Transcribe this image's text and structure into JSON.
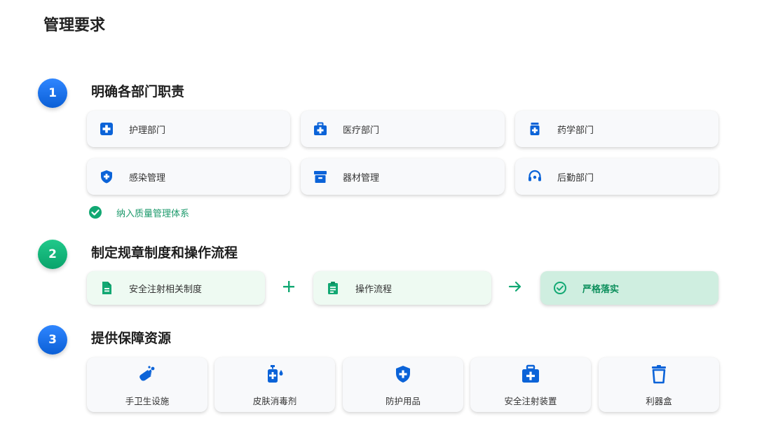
{
  "page_title": "管理要求",
  "colors": {
    "blue": "#0b63d8",
    "green": "#12a873",
    "card_bg": "#f8f9fb"
  },
  "sections": [
    {
      "number": "1",
      "title": "明确各部门职责",
      "cards": [
        {
          "label": "护理部门",
          "icon": "medical-plus-icon"
        },
        {
          "label": "医疗部门",
          "icon": "medical-kit-icon"
        },
        {
          "label": "药学部门",
          "icon": "medicine-bottle-icon"
        },
        {
          "label": "感染管理",
          "icon": "shield-plus-icon"
        },
        {
          "label": "器材管理",
          "icon": "equipment-box-icon"
        },
        {
          "label": "后勤部门",
          "icon": "support-headset-icon"
        }
      ],
      "note": "纳入质量管理体系"
    },
    {
      "number": "2",
      "title": "制定规章制度和操作流程",
      "flow": [
        {
          "label": "安全注射相关制度",
          "icon": "document-icon"
        },
        {
          "operator": "+"
        },
        {
          "label": "操作流程",
          "icon": "clipboard-icon"
        },
        {
          "operator": "→"
        },
        {
          "label": "严格落实",
          "icon": "check-circle-icon"
        }
      ]
    },
    {
      "number": "3",
      "title": "提供保障资源",
      "resources": [
        {
          "label": "手卫生设施",
          "icon": "hand-wash-icon"
        },
        {
          "label": "皮肤消毒剂",
          "icon": "sanitizer-icon"
        },
        {
          "label": "防护用品",
          "icon": "shield-plus-icon"
        },
        {
          "label": "安全注射装置",
          "icon": "medical-kit-icon"
        },
        {
          "label": "利器盒",
          "icon": "sharps-bin-icon"
        }
      ]
    }
  ]
}
